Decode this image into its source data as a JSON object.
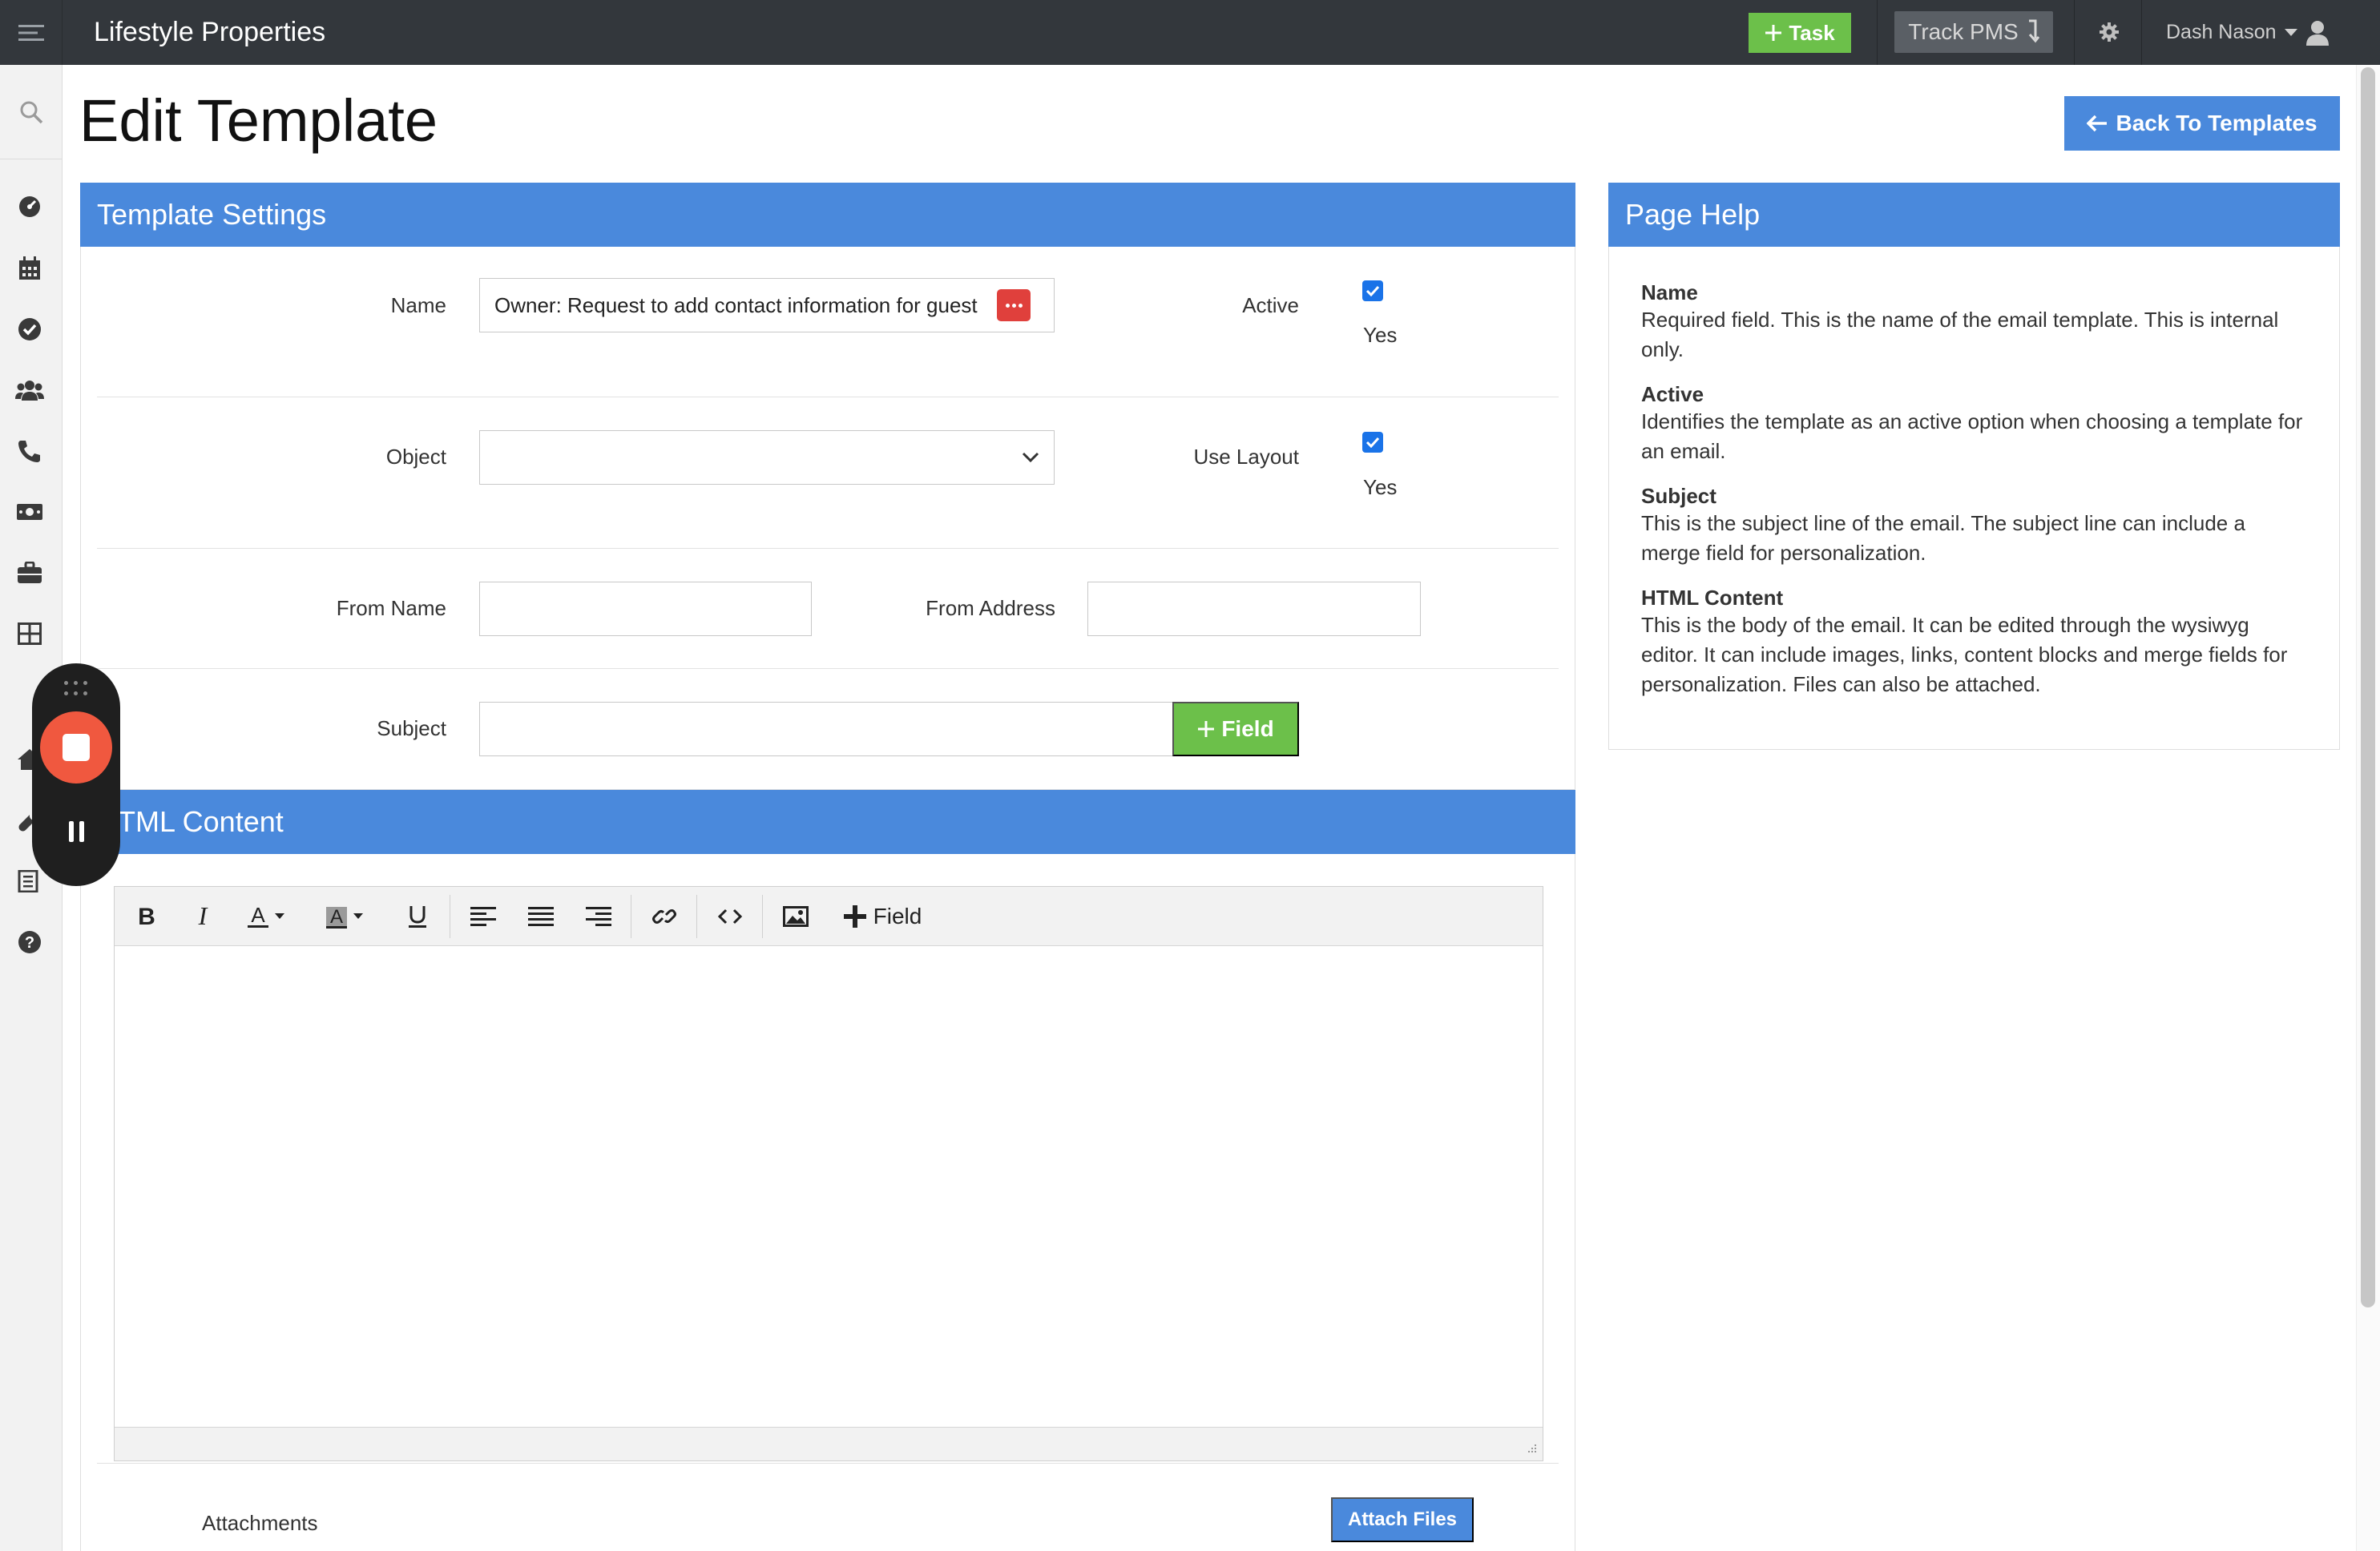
{
  "app": {
    "title": "Lifestyle Properties"
  },
  "header": {
    "task_label": "Task",
    "track_label": "Track PMS",
    "user_name": "Dash Nason"
  },
  "page": {
    "title": "Edit Template",
    "back_label": "Back To Templates"
  },
  "settings": {
    "heading": "Template Settings",
    "name_label": "Name",
    "name_value": "Owner: Request to add contact information for guest",
    "active_label": "Active",
    "active_yes": "Yes",
    "object_label": "Object",
    "object_value": "",
    "use_layout_label": "Use Layout",
    "use_layout_yes": "Yes",
    "from_name_label": "From Name",
    "from_name_value": "",
    "from_address_label": "From Address",
    "from_address_value": "",
    "subject_label": "Subject",
    "subject_value": "",
    "field_button_label": "Field"
  },
  "html_content": {
    "heading": "HTML Content",
    "toolbar_field_label": "Field",
    "attachments_label": "Attachments",
    "attach_button_label": "Attach Files"
  },
  "help": {
    "heading": "Page Help",
    "items": [
      {
        "term": "Name",
        "desc": "Required field. This is the name of the email template. This is internal only."
      },
      {
        "term": "Active",
        "desc": "Identifies the template as an active option when choosing a template for an email."
      },
      {
        "term": "Subject",
        "desc": "This is the subject line of the email. The subject line can include a merge field for personalization."
      },
      {
        "term": "HTML Content",
        "desc": "This is the body of the email. It can be edited through the wysiwyg editor. It can include images, links, content blocks and merge fields for personalization. Files can also be attached."
      }
    ]
  },
  "colors": {
    "topbar": "#33373c",
    "accent_blue": "#4a89dc",
    "accent_green": "#6cc04a",
    "record_red": "#f0583f"
  },
  "icons": {
    "sidebar": [
      "search-icon",
      "dashboard-icon",
      "calendar-icon",
      "check-circle-icon",
      "users-icon",
      "phone-icon",
      "money-icon",
      "briefcase-icon",
      "table-icon",
      "home-icon",
      "wrench-icon",
      "list-icon",
      "help-icon"
    ]
  }
}
